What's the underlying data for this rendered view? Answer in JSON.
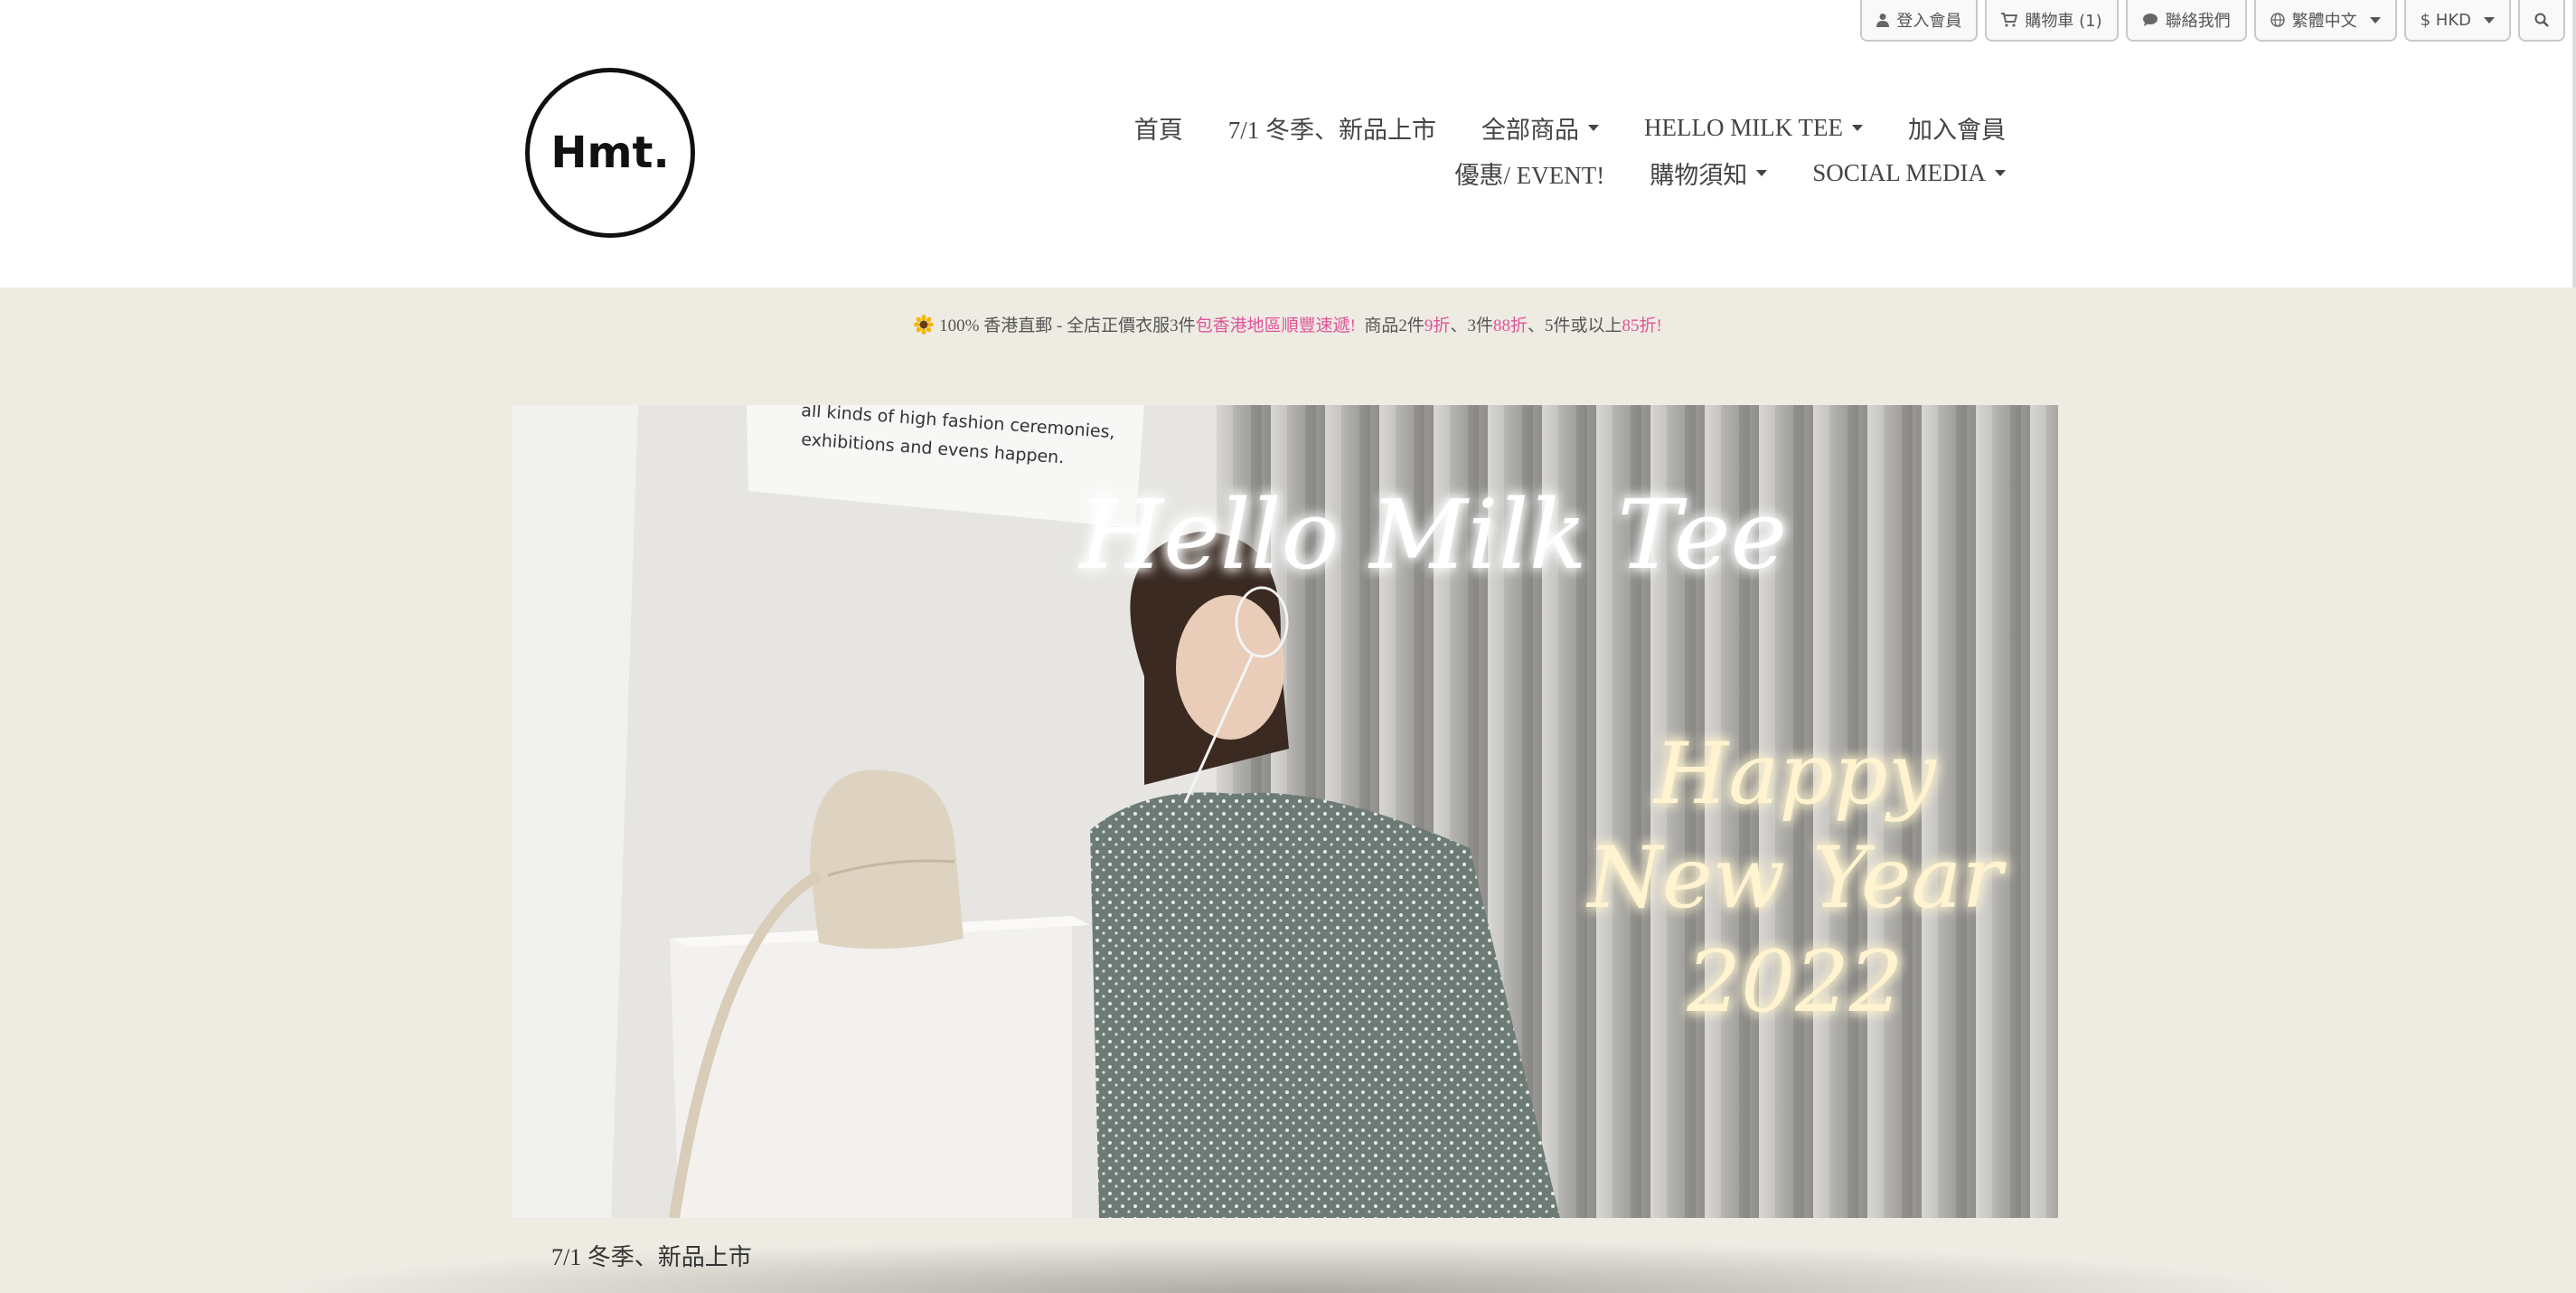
{
  "topbar": {
    "login": "登入會員",
    "cart": "購物車 (1)",
    "contact": "聯絡我們",
    "language": "繁體中文",
    "currency": "$ HKD"
  },
  "logo": {
    "text": "Hmt."
  },
  "nav": {
    "row1": [
      "首頁",
      "7/1 冬季、新品上市",
      "全部商品",
      "HELLO MILK TEE",
      "加入會員"
    ],
    "row2": [
      "優惠/ EVENT!",
      "購物須知",
      "SOCIAL MEDIA"
    ]
  },
  "announcement": {
    "part1": "100% 香港直郵 - 全店正價衣服3件",
    "part2": "包香港地區順豐速遞!",
    "part3": "商品2件",
    "part4": "9折",
    "part5": "、3件",
    "part6": "88折",
    "part7": "、5件或以上",
    "part8": "85折",
    "part9": "!"
  },
  "banner": {
    "sign_text": [
      "all kinds of high fashion ceremonies,",
      "exhibitions and evens happen."
    ],
    "headline": "Hello Milk Tee",
    "greeting_line1": "Happy",
    "greeting_line2": "New Year",
    "greeting_line3": "2022"
  },
  "caption": "7/1 冬季、新品上市",
  "colors": {
    "accent_pink": "#e0539a",
    "page_bg": "#edebe2",
    "header_bg": "#ffffff"
  }
}
